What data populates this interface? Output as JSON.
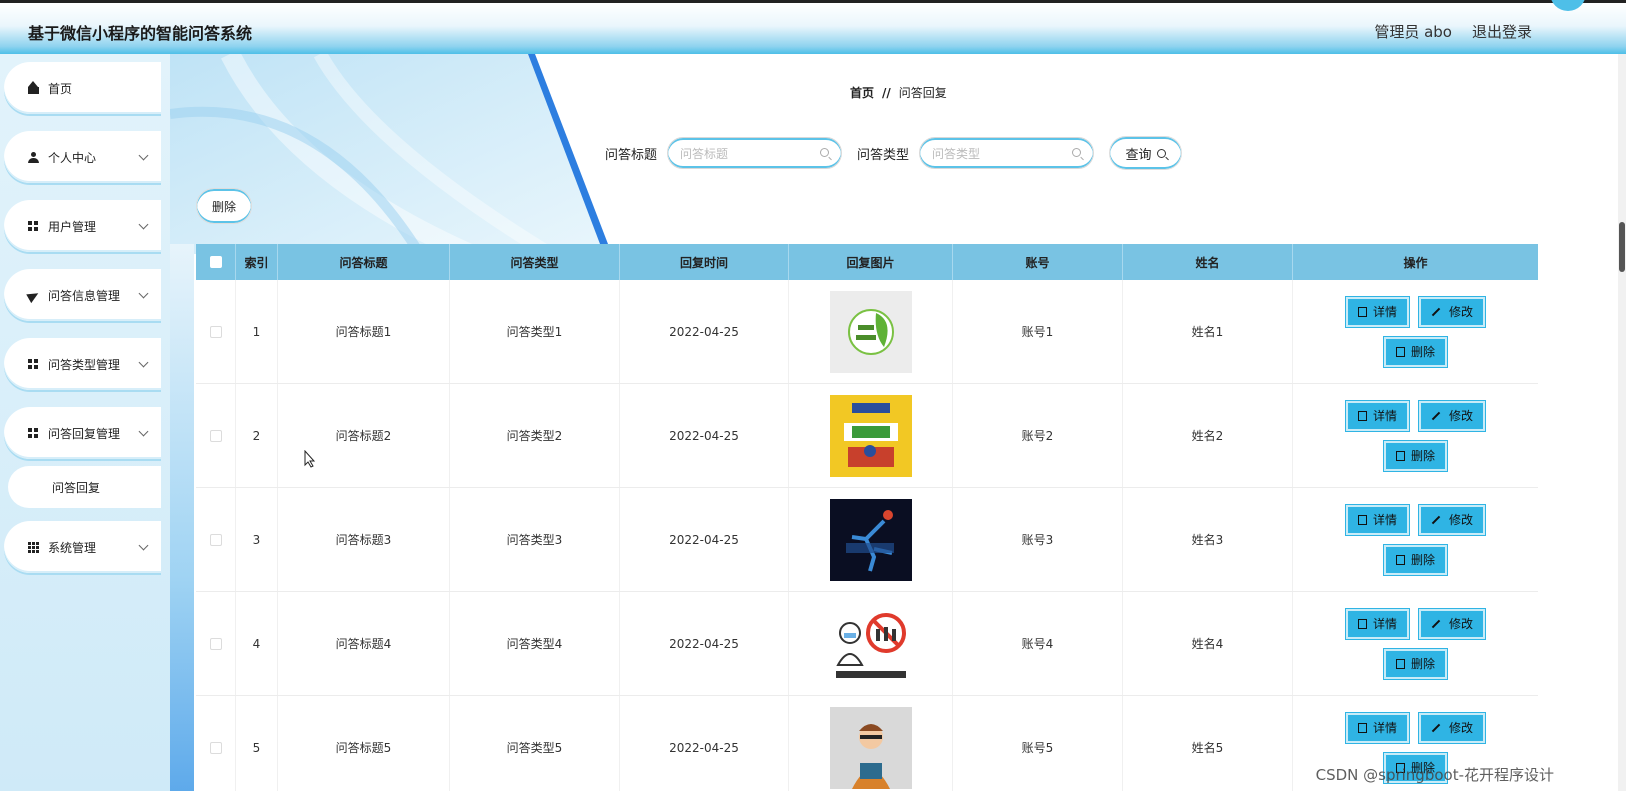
{
  "header": {
    "app_title": "基于微信小程序的智能问答系统",
    "user_label": "管理员 abo",
    "logout_label": "退出登录"
  },
  "sidebar": {
    "items": [
      {
        "label": "首页",
        "icon": "home-icon"
      },
      {
        "label": "个人中心",
        "icon": "user-icon"
      },
      {
        "label": "用户管理",
        "icon": "grid-icon"
      },
      {
        "label": "问答信息管理",
        "icon": "send-icon"
      },
      {
        "label": "问答类型管理",
        "icon": "grid-icon"
      },
      {
        "label": "问答回复管理",
        "icon": "grid-icon"
      },
      {
        "label": "系统管理",
        "icon": "grid9-icon"
      }
    ],
    "submenu": {
      "label": "问答回复"
    }
  },
  "breadcrumb": {
    "home": "首页",
    "separator": "//",
    "current": "问答回复"
  },
  "search": {
    "title_label": "问答标题",
    "title_placeholder": "问答标题",
    "type_label": "问答类型",
    "type_placeholder": "问答类型",
    "query_label": "查询"
  },
  "toolbar": {
    "delete_label": "删除"
  },
  "table": {
    "headers": [
      "索引",
      "问答标题",
      "问答类型",
      "回复时间",
      "回复图片",
      "账号",
      "姓名",
      "操作"
    ],
    "rows": [
      {
        "index": "1",
        "title": "问答标题1",
        "type": "问答类型1",
        "time": "2022-04-25",
        "image": "life-tips-logo",
        "account": "账号1",
        "name": "姓名1"
      },
      {
        "index": "2",
        "title": "问答标题2",
        "type": "问答类型2",
        "time": "2022-04-25",
        "image": "life-book-cover",
        "account": "账号2",
        "name": "姓名2"
      },
      {
        "index": "3",
        "title": "问答标题3",
        "type": "问答类型3",
        "time": "2022-04-25",
        "image": "sport-runner",
        "account": "账号3",
        "name": "姓名3"
      },
      {
        "index": "4",
        "title": "问答标题4",
        "type": "问答类型4",
        "time": "2022-04-25",
        "image": "no-gathering-sign",
        "account": "账号4",
        "name": "姓名4"
      },
      {
        "index": "5",
        "title": "问答标题5",
        "type": "问答类型5",
        "time": "2022-04-25",
        "image": "reading-man",
        "account": "账号5",
        "name": "姓名5"
      }
    ],
    "actions": {
      "detail": "详情",
      "edit": "修改",
      "delete": "删除"
    }
  },
  "watermark": "CSDN @springboot-花开程序设计",
  "colors": {
    "accent": "#2fb4e4",
    "header_blue": "#4ebfe8",
    "table_header": "#79c3e3"
  }
}
